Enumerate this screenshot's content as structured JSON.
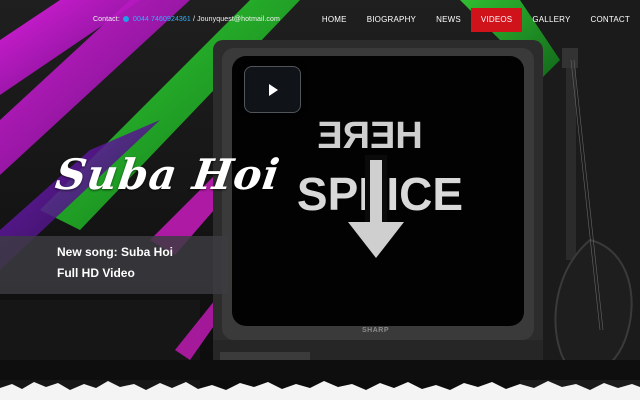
{
  "topbar": {
    "contact_label": "Contact:",
    "phone": "0044 7460924361",
    "separator": "/",
    "email": "Jounyquest@hotmail.com",
    "phone_icon": "phone-icon"
  },
  "nav": {
    "items": [
      {
        "label": "HOME",
        "active": false
      },
      {
        "label": "BIOGRAPHY",
        "active": false
      },
      {
        "label": "NEWS",
        "active": false
      },
      {
        "label": "VIDEOS",
        "active": true
      },
      {
        "label": "GALLERY",
        "active": false
      },
      {
        "label": "CONTACT",
        "active": false
      }
    ],
    "active_color": "#d0121b"
  },
  "hero": {
    "title": "Suba Hoi",
    "caption_line1": "New song: Suba Hoi",
    "caption_line2": "Full HD Video",
    "play_icon": "play-icon"
  },
  "scene": {
    "screen_top_text": "HERE",
    "screen_bottom_text": "SPLICE",
    "tv_brand": "SHARP",
    "stripe_colors": [
      "#d81ad0",
      "#2ad82a",
      "#6a1ab0"
    ]
  }
}
